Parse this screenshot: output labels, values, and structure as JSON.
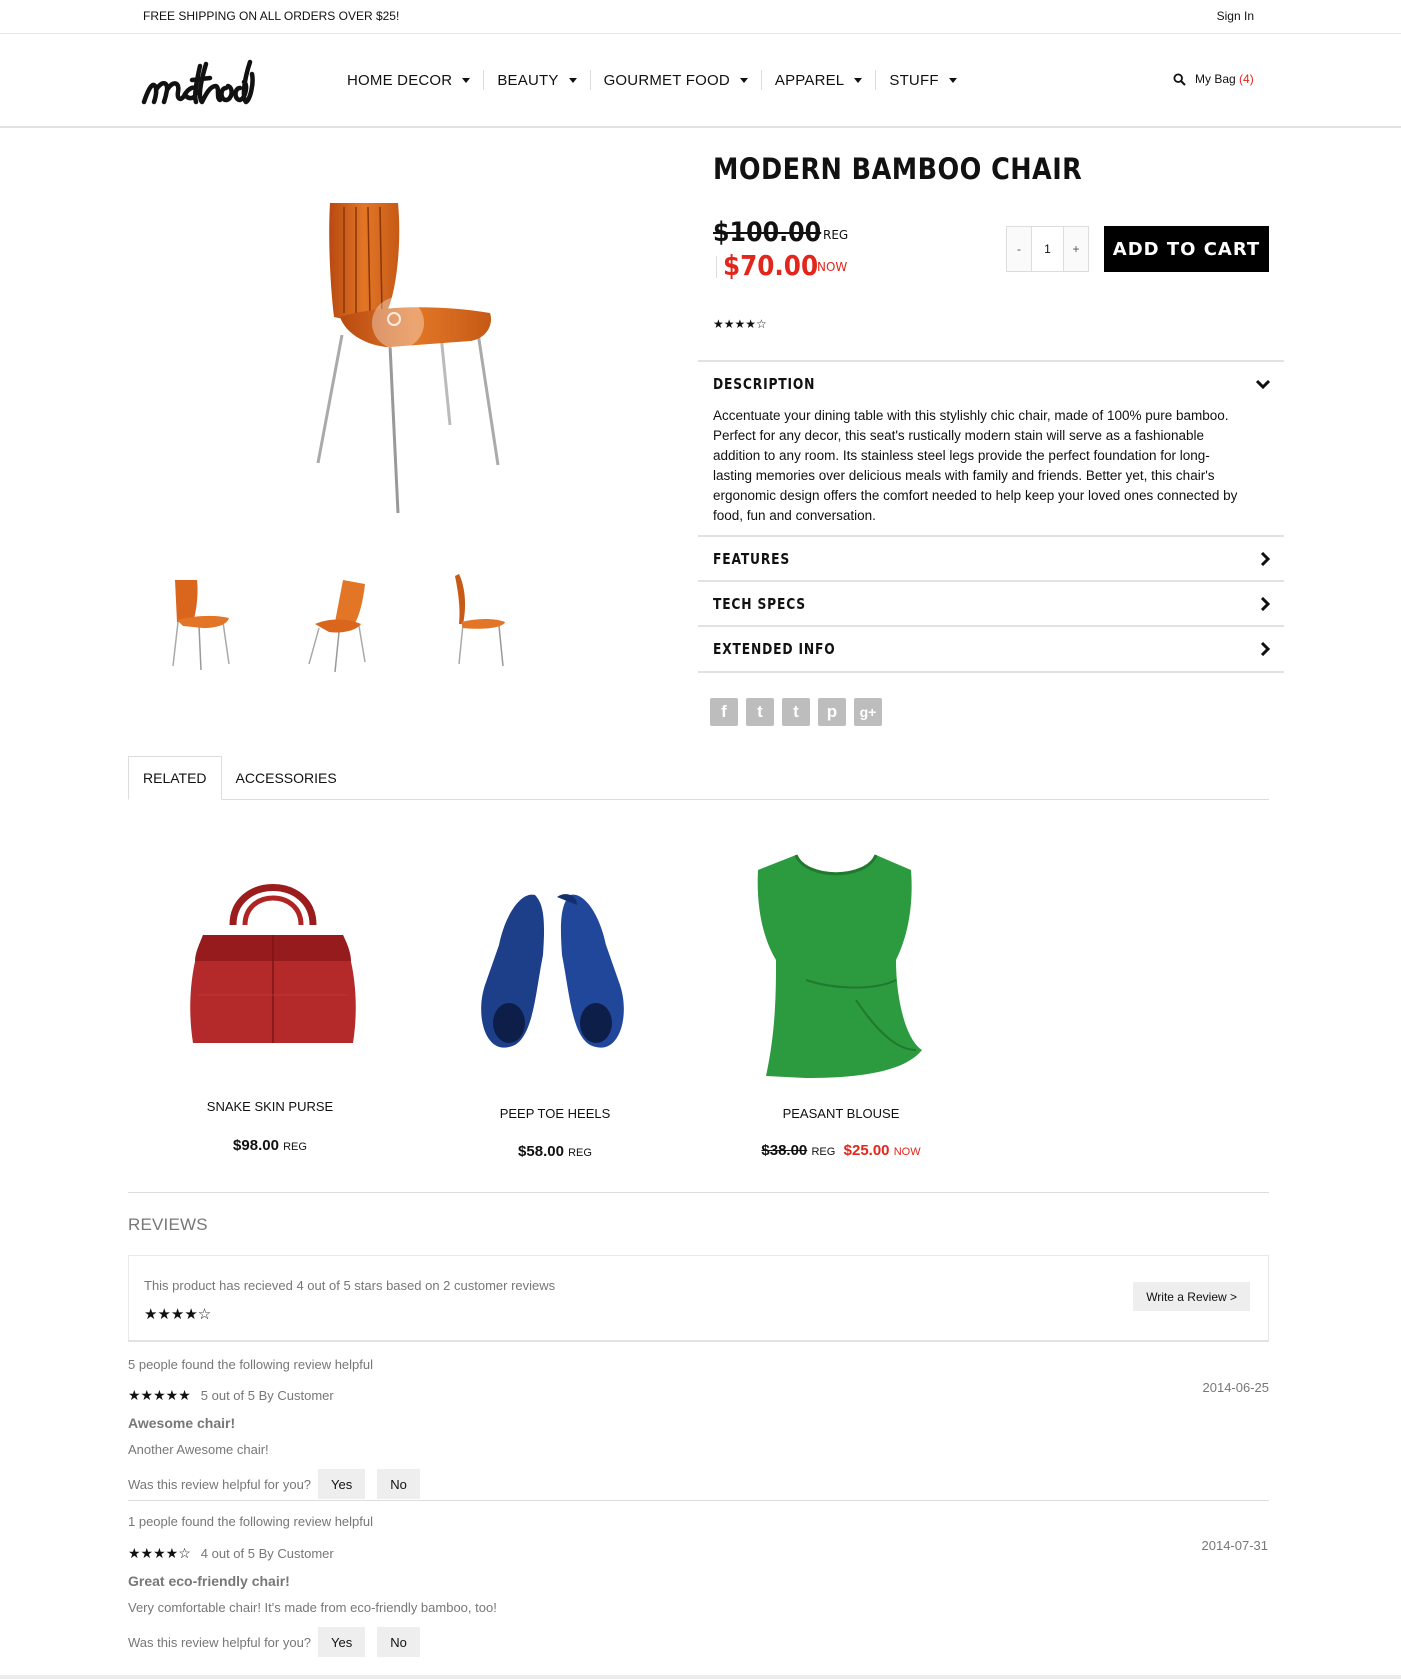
{
  "topbar": {
    "shipping": "FREE SHIPPING ON ALL ORDERS OVER $25!",
    "signin": "Sign In"
  },
  "header": {
    "logo_text": "method",
    "nav": [
      "HOME DECOR",
      "BEAUTY",
      "GOURMET FOOD",
      "APPAREL",
      "STUFF"
    ],
    "search_icon": "search-icon",
    "bag_label": "My Bag",
    "bag_count": "(4)"
  },
  "product": {
    "title": "MODERN BAMBOO CHAIR",
    "price_reg": "$100.00",
    "reg_label": "REG",
    "price_now": "$70.00",
    "now_label": "NOW",
    "rating_stars": "★★★★☆",
    "qty_minus": "-",
    "qty_value": "1",
    "qty_plus": "+",
    "add_to_cart": "ADD TO CART",
    "accordion": [
      {
        "title": "DESCRIPTION",
        "icon": "chevron-down-icon",
        "body": "Accentuate your dining table with this stylishly chic chair, made of 100% pure bamboo. Perfect for any decor, this seat's rustically modern stain will serve as a fashionable addition to any room. Its stainless steel legs provide the perfect foundation for long-lasting memories over delicious meals with family and friends. Better yet, this chair's ergonomic design offers the comfort needed to help keep your loved ones connected by food, fun and conversation."
      },
      {
        "title": "FEATURES",
        "icon": "chevron-right-icon"
      },
      {
        "title": "TECH SPECS",
        "icon": "chevron-right-icon"
      },
      {
        "title": "EXTENDED INFO",
        "icon": "chevron-right-icon"
      }
    ],
    "social": [
      {
        "icon": "facebook-icon",
        "glyph": "f"
      },
      {
        "icon": "twitter-icon",
        "glyph": "t"
      },
      {
        "icon": "tumblr-icon",
        "glyph": "t"
      },
      {
        "icon": "pinterest-icon",
        "glyph": "p"
      },
      {
        "icon": "google-plus-icon",
        "glyph": "g+"
      }
    ]
  },
  "tabs": [
    "RELATED",
    "ACCESSORIES"
  ],
  "related": [
    {
      "name": "SNAKE SKIN PURSE",
      "price": "$98.00",
      "price_label": "REG"
    },
    {
      "name": "PEEP TOE HEELS",
      "price": "$58.00",
      "price_label": "REG"
    },
    {
      "name": "PEASANT BLOUSE",
      "price_old": "$38.00",
      "old_label": "REG",
      "price_new": "$25.00",
      "new_label": "NOW"
    }
  ],
  "reviews": {
    "heading": "REVIEWS",
    "summary": "This product has recieved 4 out of 5 stars based on 2 customer reviews",
    "summary_stars": "★★★★☆",
    "write_button": "Write a Review >",
    "items": [
      {
        "helpful_count": "5 people found the following review helpful",
        "stars": "★★★★★",
        "rating_text": "5 out of 5 By Customer",
        "date": "2014-06-25",
        "title": "Awesome chair!",
        "body": "Another Awesome chair!",
        "question": "Was this review helpful for you?",
        "yes": "Yes",
        "no": "No"
      },
      {
        "helpful_count": "1 people found the following review helpful",
        "stars": "★★★★☆",
        "rating_text": "4 out of 5 By Customer",
        "date": "2014-07-31",
        "title": "Great eco-friendly chair!",
        "body": "Very comfortable chair! It's made from eco-friendly bamboo, too!",
        "question": "Was this review helpful for you?",
        "yes": "Yes",
        "no": "No"
      }
    ]
  }
}
